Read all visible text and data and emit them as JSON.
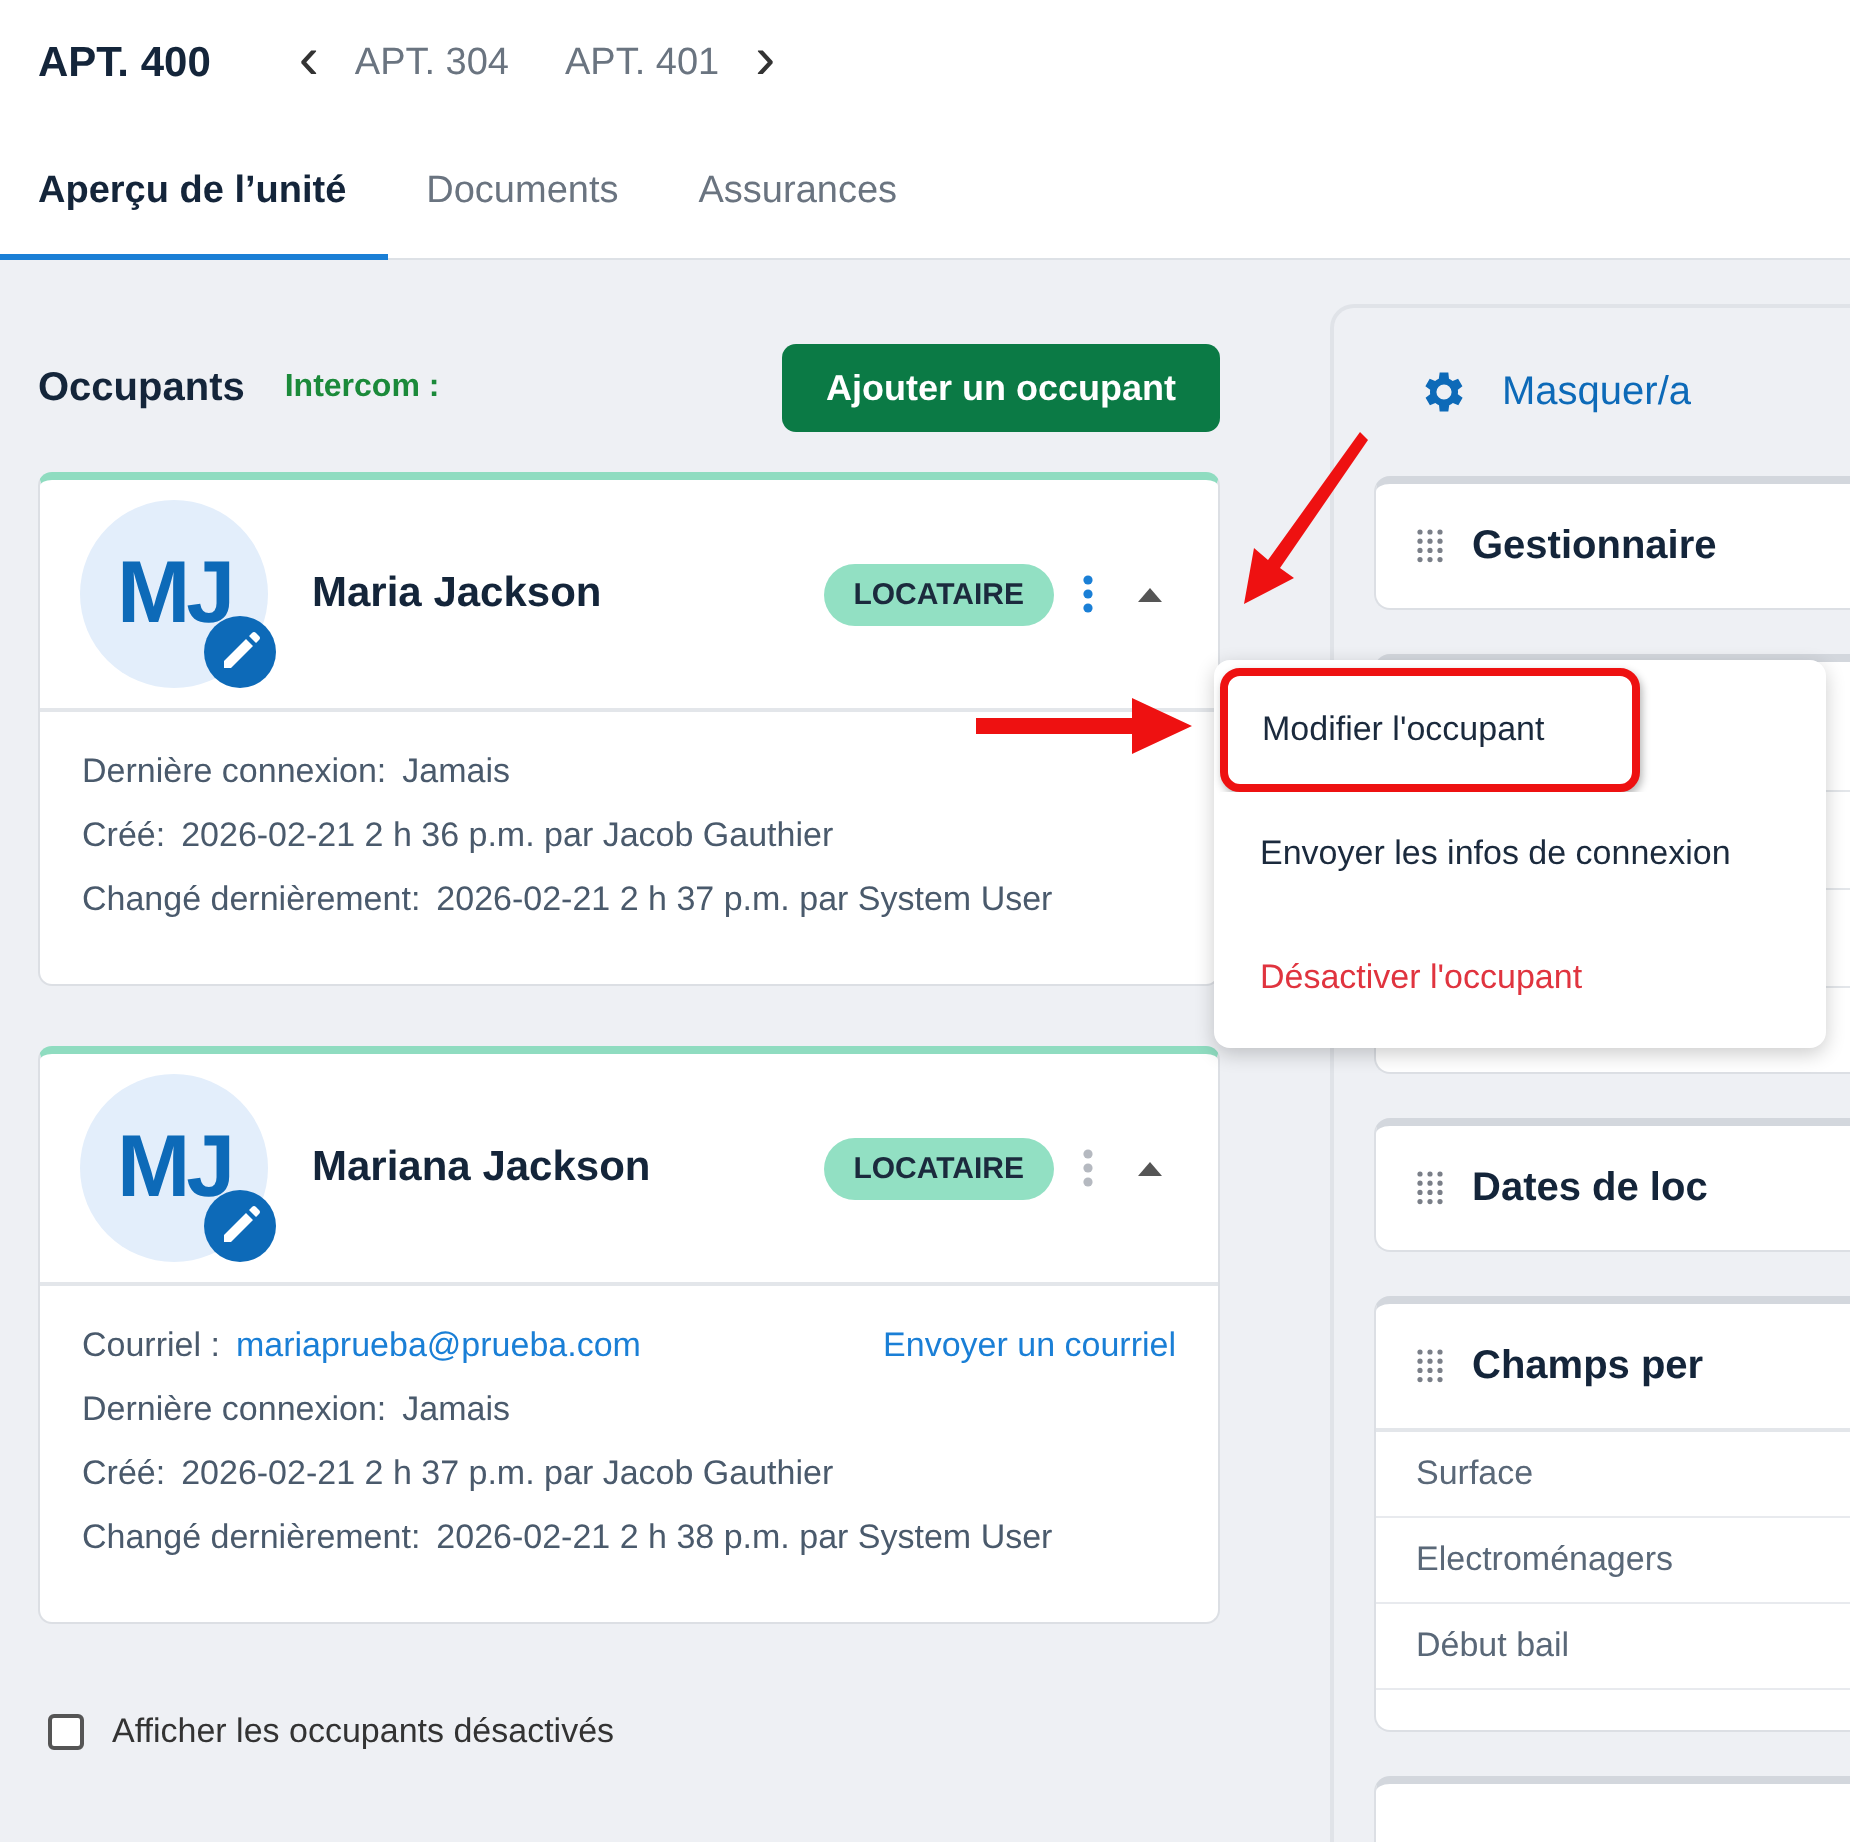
{
  "unit": {
    "title": "APT. 400",
    "prev": "APT. 304",
    "next": "APT. 401",
    "prev_icon": "‹",
    "next_icon": "›"
  },
  "tabs": [
    {
      "label": "Aperçu de l’unité",
      "selected": true
    },
    {
      "label": "Documents",
      "selected": false
    },
    {
      "label": "Assurances",
      "selected": false
    }
  ],
  "occupants_section": {
    "title": "Occupants",
    "intercom_label": "Intercom :",
    "add_button": "Ajouter un occupant"
  },
  "occupants": [
    {
      "initials": "MJ",
      "name": "Maria Jackson",
      "role": "LOCATAIRE",
      "menu_open": true,
      "fields": [
        {
          "kind": "text",
          "label": "Dernière connexion:",
          "value": "Jamais"
        },
        {
          "kind": "text",
          "label": "Créé:",
          "value": "2026-02-21 2 h 36 p.m. par Jacob Gauthier"
        },
        {
          "kind": "text",
          "label": "Changé dernièrement:",
          "value": "2026-02-21 2 h 37 p.m. par System User"
        }
      ]
    },
    {
      "initials": "MJ",
      "name": "Mariana Jackson",
      "role": "LOCATAIRE",
      "menu_open": false,
      "fields": [
        {
          "kind": "email",
          "label": "Courriel :",
          "value": "mariaprueba@prueba.com",
          "action": "Envoyer un courriel"
        },
        {
          "kind": "text",
          "label": "Dernière connexion:",
          "value": "Jamais"
        },
        {
          "kind": "text",
          "label": "Créé:",
          "value": "2026-02-21 2 h 37 p.m. par Jacob Gauthier"
        },
        {
          "kind": "text",
          "label": "Changé dernièrement:",
          "value": "2026-02-21 2 h 38 p.m. par System User"
        }
      ]
    }
  ],
  "menu": {
    "items": [
      {
        "label": "Modifier l'occupant",
        "kind": "normal",
        "highlighted": true
      },
      {
        "label": "Envoyer les infos de connexion",
        "kind": "normal",
        "highlighted": false
      },
      {
        "label": "Désactiver l'occupant",
        "kind": "danger",
        "highlighted": false
      }
    ]
  },
  "show_deactivated": {
    "label": "Afficher les occupants désactivés",
    "checked": false
  },
  "side_panel": {
    "settings_link": "Masquer/a",
    "sections": [
      {
        "kind": "header",
        "title": "Gestionnaire"
      },
      {
        "kind": "covered"
      },
      {
        "kind": "header",
        "title": "Dates de loc"
      },
      {
        "kind": "rows",
        "title": "Champs per",
        "rows": [
          "Surface",
          "Electroménagers",
          "Début bail"
        ]
      },
      {
        "kind": "stub"
      }
    ]
  }
}
